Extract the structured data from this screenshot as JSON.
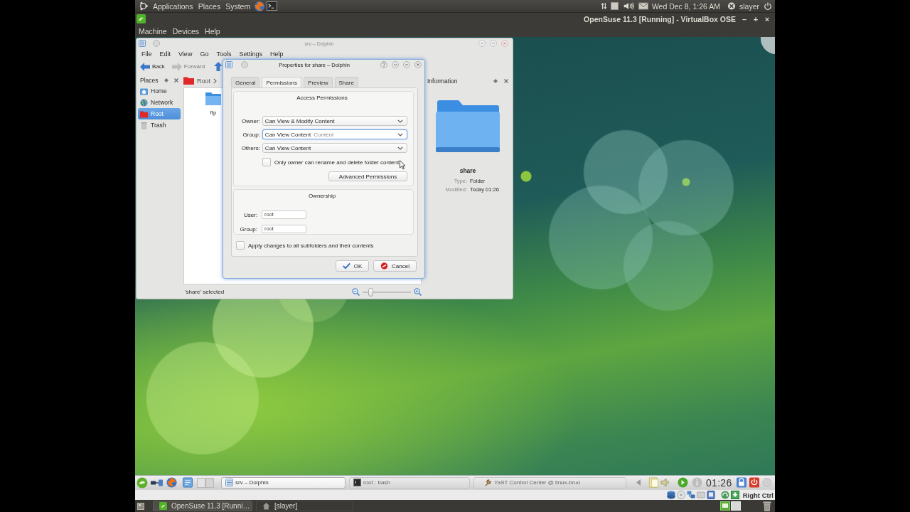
{
  "top_panel": {
    "menus": [
      "Applications",
      "Places",
      "System"
    ],
    "clock": "Wed Dec 8, 1:26 AM",
    "user": "slayer"
  },
  "vm_window": {
    "title": "OpenSuse 11.3 [Running] - VirtualBox OSE",
    "controls": [
      "–",
      "+",
      "×"
    ],
    "menus": [
      "Machine",
      "Devices",
      "Help"
    ],
    "host_key": "Right Ctrl"
  },
  "dolphin": {
    "title": "srv – Dolphin",
    "menus": [
      "File",
      "Edit",
      "View",
      "Go",
      "Tools",
      "Settings",
      "Help"
    ],
    "toolbar": [
      {
        "label": "Back",
        "disabled": false
      },
      {
        "label": "Forward",
        "disabled": true
      }
    ],
    "places": {
      "title": "Places",
      "items": [
        {
          "label": "Home",
          "selected": false
        },
        {
          "label": "Network",
          "selected": false
        },
        {
          "label": "Root",
          "selected": true
        },
        {
          "label": "Trash",
          "selected": false
        }
      ]
    },
    "breadcrumb": "Root",
    "files": [
      {
        "name": "ftp"
      }
    ],
    "information": {
      "title": "Information",
      "name": "share",
      "fields": [
        {
          "label": "Type:",
          "value": "Folder"
        },
        {
          "label": "Modified:",
          "value": "Today 01:26"
        }
      ]
    },
    "status": "'share' selected",
    "zoom": {
      "level": 0.13
    }
  },
  "properties_dialog": {
    "title": "Properties for share – Dolphin",
    "tabs": [
      {
        "label": "General",
        "selected": false
      },
      {
        "label": "Permissions",
        "selected": true
      },
      {
        "label": "Preview",
        "selected": false
      },
      {
        "label": "Share",
        "selected": false
      }
    ],
    "access": {
      "title": "Access Permissions",
      "rows": [
        {
          "label": "Owner:",
          "value": "Can View & Modify Content",
          "focused": false
        },
        {
          "label": "Group:",
          "value": "Can View Content",
          "faded_text": "Content",
          "focused": true
        },
        {
          "label": "Others:",
          "value": "Can View Content",
          "focused": false
        }
      ],
      "owner_only": {
        "label": "Only owner can rename and delete folder content",
        "checked": false
      },
      "advanced_button": "Advanced Permissions"
    },
    "ownership": {
      "title": "Ownership",
      "fields": [
        {
          "label": "User:",
          "value": "root"
        },
        {
          "label": "Group:",
          "value": "root"
        }
      ]
    },
    "apply_recursive": {
      "label": "Apply changes to all subfolders and their contents",
      "checked": false
    },
    "buttons": [
      {
        "label": "OK",
        "kind": "ok"
      },
      {
        "label": "Cancel",
        "kind": "cancel"
      }
    ]
  },
  "kde_panel": {
    "tasks": [
      {
        "label": "srv – Dolphin",
        "selected": true
      },
      {
        "label": "root : bash",
        "selected": false
      },
      {
        "label": "YaST Control Center @ linux-bruo",
        "selected": false
      }
    ],
    "clock": "01:26"
  },
  "bottom_panel": {
    "windows": [
      {
        "label": "OpenSuse 11.3 [Runni…",
        "selected": true
      },
      {
        "label": "[slayer]",
        "selected": false
      }
    ]
  }
}
